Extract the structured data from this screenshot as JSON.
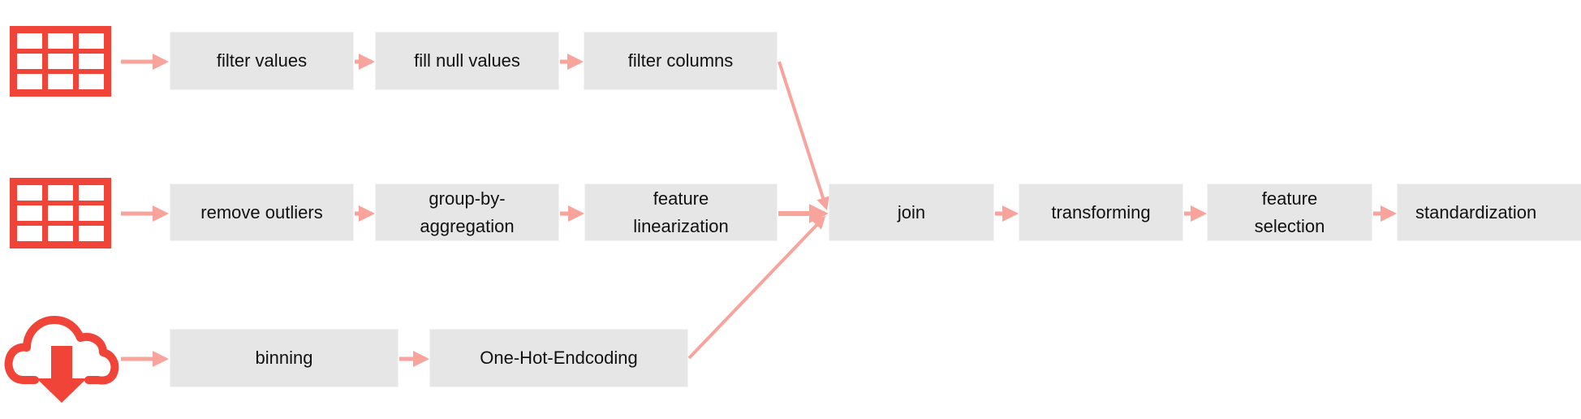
{
  "colors": {
    "node_fill": "#e6e6e6",
    "arrow": "#f8a39b",
    "icon": "#f04438",
    "text": "#111111"
  },
  "sources": [
    {
      "id": "table-1",
      "icon": "table-icon"
    },
    {
      "id": "table-2",
      "icon": "table-icon"
    },
    {
      "id": "cloud-download",
      "icon": "cloud-download-icon"
    }
  ],
  "pipelines": {
    "row1": [
      "filter values",
      "fill null values",
      "filter columns"
    ],
    "row2": [
      "remove outliers",
      "group-by-\naggregation",
      "feature\nlinearization"
    ],
    "row3": [
      "binning",
      "One-Hot-Endcoding"
    ]
  },
  "merge": [
    "join",
    "transforming",
    "feature\nselection",
    "standardization"
  ],
  "edges": [
    {
      "from": "table-1",
      "to": "filter values"
    },
    {
      "from": "filter values",
      "to": "fill null values"
    },
    {
      "from": "fill null values",
      "to": "filter columns"
    },
    {
      "from": "filter columns",
      "to": "join"
    },
    {
      "from": "table-2",
      "to": "remove outliers"
    },
    {
      "from": "remove outliers",
      "to": "group-by-aggregation"
    },
    {
      "from": "group-by-aggregation",
      "to": "feature linearization"
    },
    {
      "from": "feature linearization",
      "to": "join"
    },
    {
      "from": "cloud-download",
      "to": "binning"
    },
    {
      "from": "binning",
      "to": "One-Hot-Endcoding"
    },
    {
      "from": "One-Hot-Endcoding",
      "to": "join"
    },
    {
      "from": "join",
      "to": "transforming"
    },
    {
      "from": "transforming",
      "to": "feature selection"
    },
    {
      "from": "feature selection",
      "to": "standardization"
    }
  ]
}
